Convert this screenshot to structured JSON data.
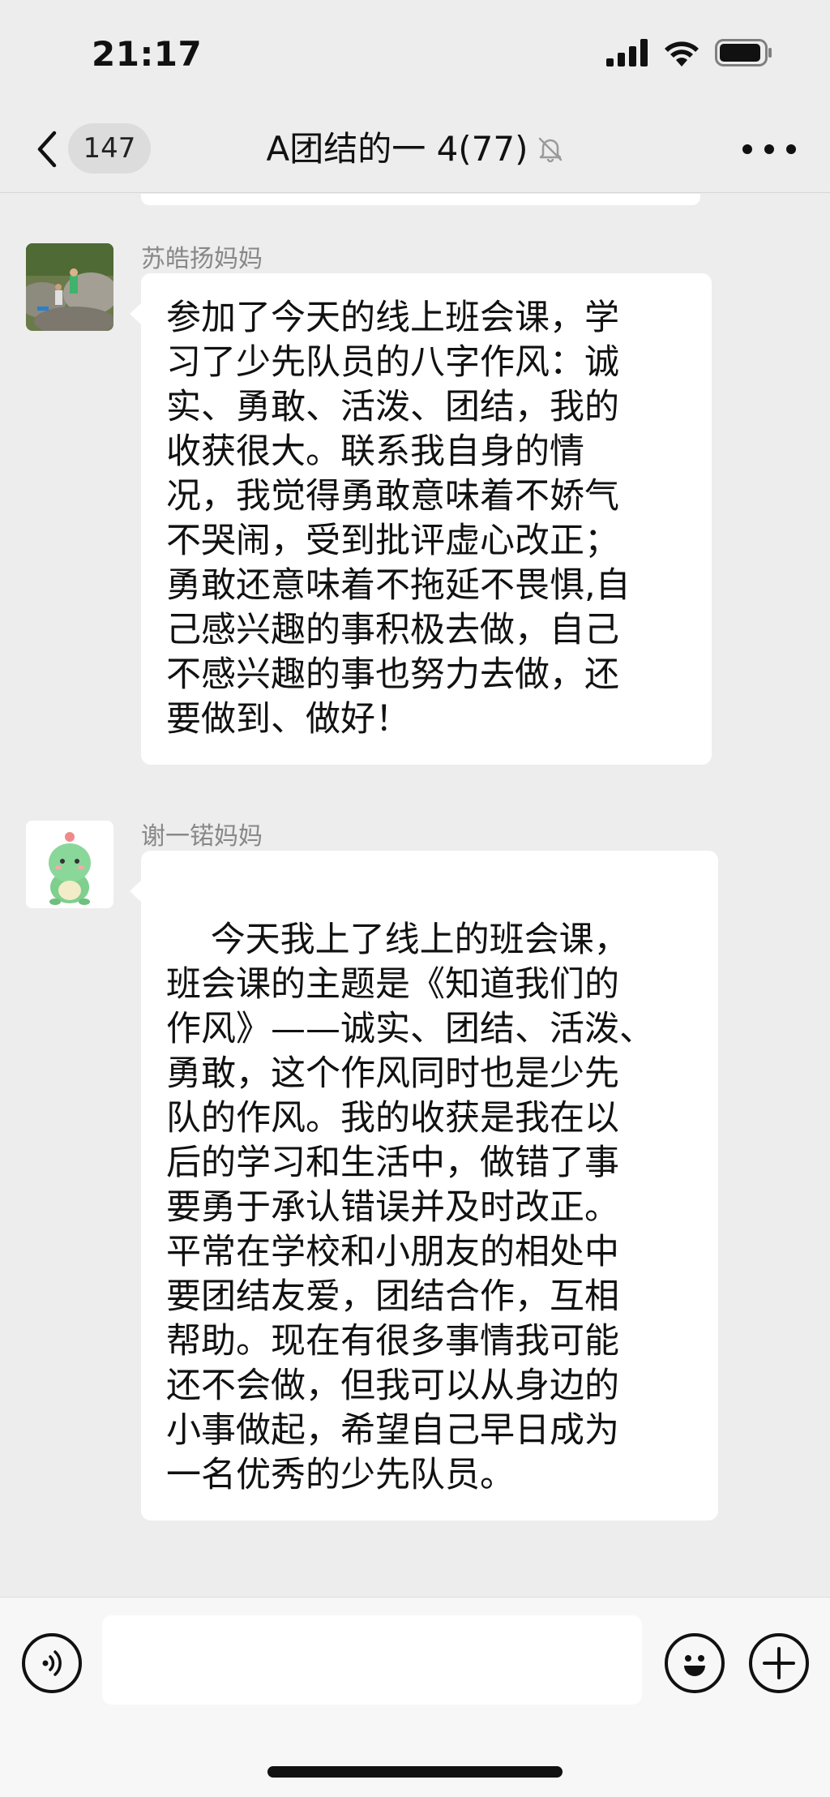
{
  "status_bar": {
    "time": "21:17"
  },
  "nav": {
    "unread_count": "147",
    "title": "A团结的一 4(77)"
  },
  "messages": [
    {
      "sender": "苏皓扬妈妈",
      "text": "参加了今天的线上班会课，学\n习了少先队员的八字作风：诚\n实、勇敢、活泼、团结，我的\n收获很大。联系我自身的情\n况，我觉得勇敢意味着不娇气\n不哭闹，受到批评虚心改正；\n勇敢还意味着不拖延不畏惧,自\n己感兴趣的事积极去做，自己\n不感兴趣的事也努力去做，还\n要做到、做好！"
    },
    {
      "sender": "谢一锘妈妈",
      "text": "\n    今天我上了线上的班会课，\n班会课的主题是《知道我们的\n作风》——诚实、团结、活泼、\n勇敢，这个作风同时也是少先\n队的作风。我的收获是我在以\n后的学习和生活中，做错了事\n要勇于承认错误并及时改正。\n平常在学校和小朋友的相处中\n要团结友爱，团结合作，互相\n帮助。现在有很多事情我可能\n还不会做，但我可以从身边的\n小事做起，希望自己早日成为\n一名优秀的少先队员。"
    }
  ],
  "input": {
    "placeholder": ""
  },
  "colors": {
    "background": "#ededed",
    "bubble": "#ffffff",
    "sender_name": "#888888"
  },
  "icons": [
    "back-chevron-icon",
    "mute-bell-icon",
    "more-dots-icon",
    "voice-icon",
    "emoji-icon",
    "plus-icon",
    "signal-icon",
    "wifi-icon",
    "battery-icon"
  ]
}
